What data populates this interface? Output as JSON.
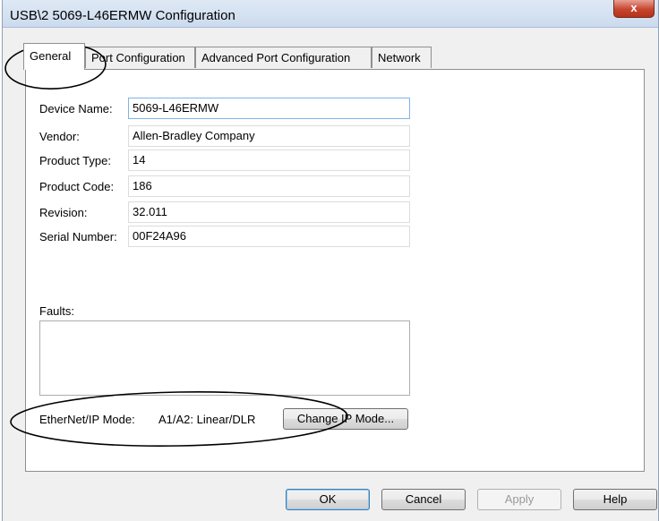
{
  "window": {
    "title": "USB\\2 5069-L46ERMW Configuration",
    "close_glyph": "x"
  },
  "tabs": [
    {
      "label": "General",
      "active": true
    },
    {
      "label": "Port Configuration"
    },
    {
      "label": "Advanced Port Configuration"
    },
    {
      "label": "Network"
    }
  ],
  "general": {
    "device_name": {
      "label": "Device Name:",
      "value": "5069-L46ERMW"
    },
    "vendor": {
      "label": "Vendor:",
      "value": "Allen-Bradley Company"
    },
    "product_type": {
      "label": "Product Type:",
      "value": "14"
    },
    "product_code": {
      "label": "Product Code:",
      "value": "186"
    },
    "revision": {
      "label": "Revision:",
      "value": "32.011"
    },
    "serial_number": {
      "label": "Serial Number:",
      "value": "00F24A96"
    },
    "faults_label": "Faults:",
    "ethernet_mode_label": "EtherNet/IP Mode:",
    "ethernet_mode_value": "A1/A2: Linear/DLR",
    "change_ip_mode_label": "Change IP Mode..."
  },
  "buttons": {
    "ok": "OK",
    "cancel": "Cancel",
    "apply": "Apply",
    "help": "Help"
  },
  "colors": {
    "annotation": "#000000",
    "focus": "#7eb4ea"
  }
}
